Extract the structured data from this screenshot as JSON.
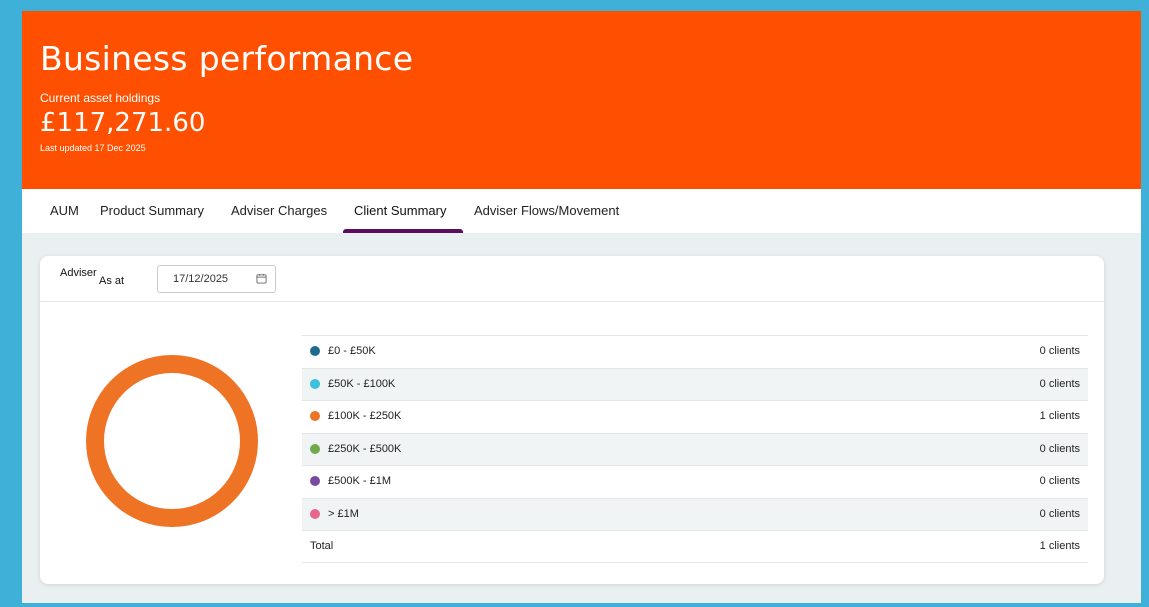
{
  "header": {
    "title": "Business performance",
    "subtitle": "Current asset holdings",
    "value": "£117,271.60",
    "updated": "Last updated 17 Dec 2025",
    "color": "#fe5000"
  },
  "tabs": [
    {
      "label": "AUM"
    },
    {
      "label": "Product Summary"
    },
    {
      "label": "Adviser Charges"
    },
    {
      "label": "Client Summary",
      "active": true
    },
    {
      "label": "Adviser Flows/Movement"
    }
  ],
  "filters": {
    "adviser_label": "Adviser",
    "as_at_label": "As at",
    "date_value": "17/12/2025",
    "calendar_icon": "calendar-icon"
  },
  "chart_data": {
    "type": "pie",
    "style": "donut",
    "categories": [
      "£0 - £50K",
      "£50K - £100K",
      "£100K - £250K",
      "£250K - £500K",
      "£500K - £1M",
      "> £1M"
    ],
    "values": [
      0,
      0,
      1,
      0,
      0,
      0
    ],
    "colors": [
      "#1f6b8e",
      "#3ebfdb",
      "#ee7324",
      "#70a94a",
      "#7a4aa0",
      "#e8668e"
    ]
  },
  "legend": {
    "rows": [
      {
        "label": "£0 - £50K",
        "count": "0 clients",
        "color": "#1f6b8e"
      },
      {
        "label": "£50K - £100K",
        "count": "0 clients",
        "color": "#3ebfdb"
      },
      {
        "label": "£100K - £250K",
        "count": "1 clients",
        "color": "#ee7324"
      },
      {
        "label": "£250K - £500K",
        "count": "0 clients",
        "color": "#70a94a"
      },
      {
        "label": "£500K - £1M",
        "count": "0 clients",
        "color": "#7a4aa0"
      },
      {
        "label": "> £1M",
        "count": "0 clients",
        "color": "#e8668e"
      }
    ],
    "total_label": "Total",
    "total_count": "1 clients"
  }
}
